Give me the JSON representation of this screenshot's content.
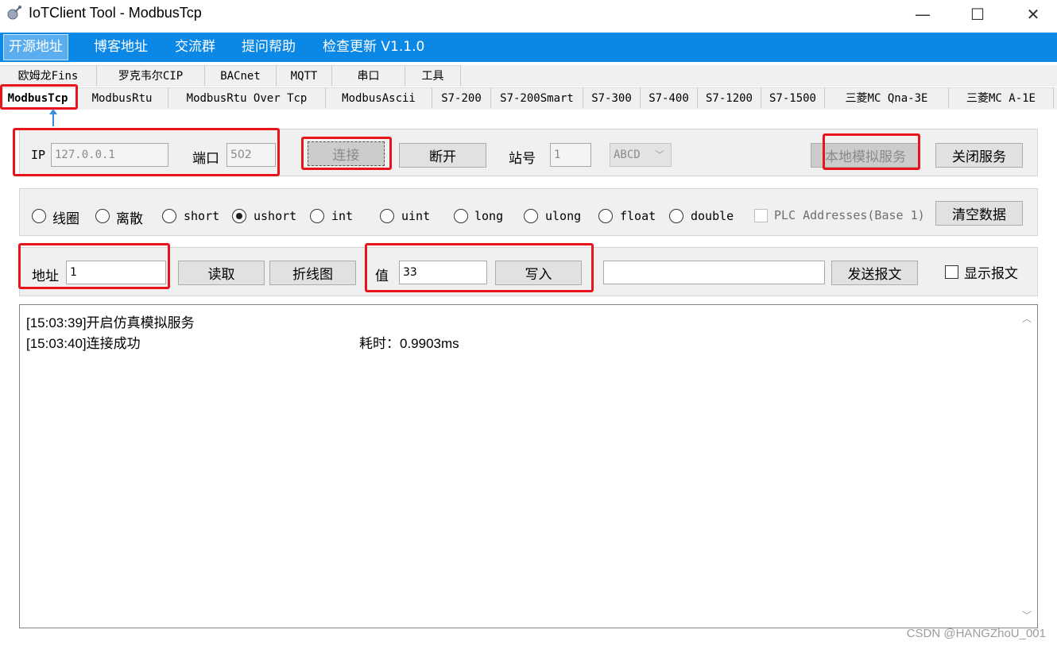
{
  "window": {
    "title": "IoTClient Tool - ModbusTcp",
    "minimize": "—",
    "maximize": "☐",
    "close": "✕"
  },
  "menu": [
    "开源地址",
    "博客地址",
    "交流群",
    "提问帮助",
    "检查更新 V1.1.0"
  ],
  "tabs_row1": [
    "欧姆龙Fins",
    "罗克韦尔CIP",
    "BACnet",
    "MQTT",
    "串口",
    "工具"
  ],
  "tabs_row2": [
    "ModbusTcp",
    "ModbusRtu",
    "ModbusRtu Over Tcp",
    "ModbusAscii",
    "S7-200",
    "S7-200Smart",
    "S7-300",
    "S7-400",
    "S7-1200",
    "S7-1500",
    "三菱MC Qna-3E",
    "三菱MC A-1E"
  ],
  "active_tab": "ModbusTcp",
  "connection": {
    "ip_label": "IP",
    "ip_value": "127.0.0.1",
    "port_label": "端口",
    "port_value": "502",
    "connect_button": "连接",
    "disconnect_button": "断开",
    "station_label": "站号",
    "station_value": "1",
    "byte_order": "ABCD",
    "local_sim_button": "本地模拟服务",
    "close_service_button": "关闭服务"
  },
  "datatypes": {
    "options": [
      "线圈",
      "离散",
      "short",
      "ushort",
      "int",
      "uint",
      "long",
      "ulong",
      "float",
      "double"
    ],
    "selected": "ushort",
    "plc_addresses_label": "PLC Addresses(Base 1)",
    "plc_addresses_checked": false,
    "clear_button": "清空数据"
  },
  "operation": {
    "address_label": "地址",
    "address_value": "1",
    "read_button": "读取",
    "chart_button": "折线图",
    "value_label": "值",
    "value_value": "33",
    "write_button": "写入",
    "packet_value": "",
    "send_packet_button": "发送报文",
    "show_packet_label": "显示报文",
    "show_packet_checked": false
  },
  "log": [
    {
      "text": "[15:03:39]开启仿真模拟服务",
      "extra": ""
    },
    {
      "text": "[15:03:40]连接成功",
      "extra": "耗时：0.9903ms"
    }
  ],
  "watermark": "CSDN @HANGZhoU_001",
  "colors": {
    "menubar": "#0b87e6",
    "highlight": "#e8141c",
    "annotation_arrow": "#3a8fdc"
  }
}
